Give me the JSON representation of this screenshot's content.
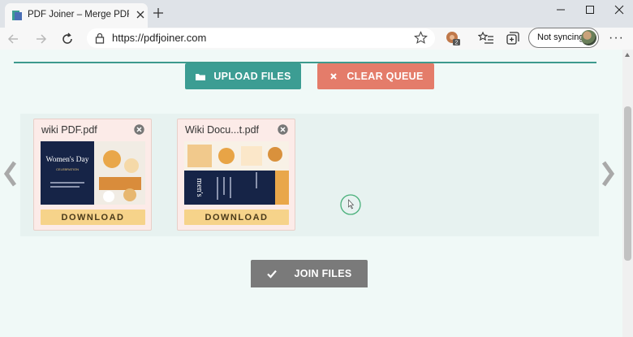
{
  "browser": {
    "tab_title": "PDF Joiner – Merge PDF Files Or",
    "url": "https://pdfjoiner.com",
    "sync_label": "Not syncing",
    "profile_badge": "2"
  },
  "actions": {
    "upload_label": "UPLOAD FILES",
    "clear_label": "CLEAR QUEUE",
    "join_label": "JOIN FILES"
  },
  "queue": {
    "files": [
      {
        "name": "wiki PDF.pdf",
        "download_label": "DOWNLOAD",
        "thumb_heading": "Women's Day",
        "thumb_sub": "CELEBRATION"
      },
      {
        "name": "Wiki Docu...t.pdf",
        "download_label": "DOWNLOAD",
        "thumb_heading": "men's"
      }
    ]
  },
  "colors": {
    "accent_teal": "#3c9d93",
    "accent_coral": "#e47c6a",
    "join_gray": "#7a7a7a",
    "download_yellow": "#f6d38a",
    "card_bg": "#fcebe8"
  }
}
